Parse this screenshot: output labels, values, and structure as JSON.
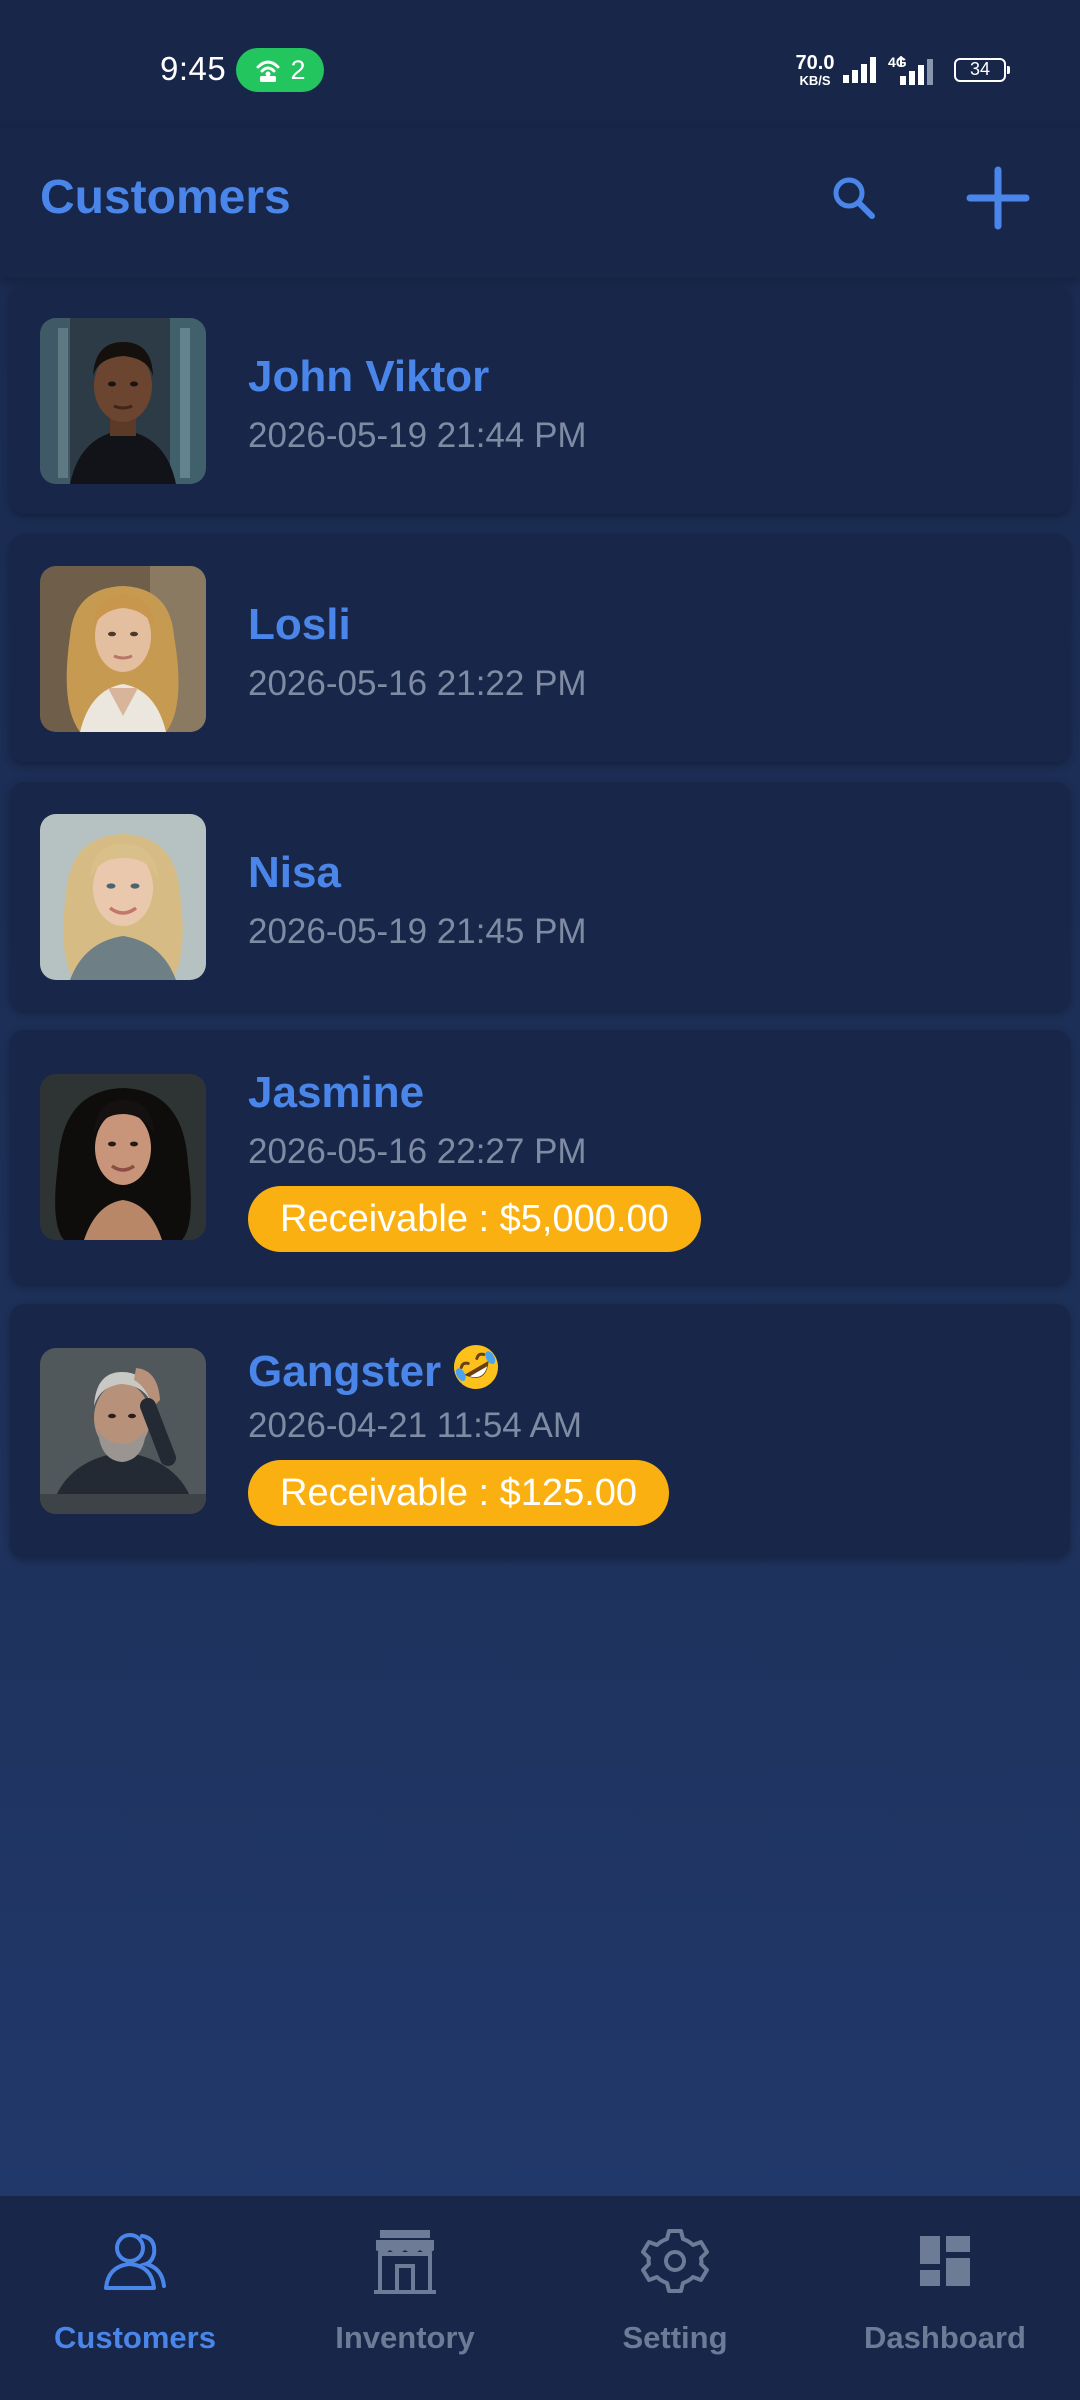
{
  "status_bar": {
    "time": "9:45",
    "hotspot_count": "2",
    "net_speed_value": "70.0",
    "net_speed_unit": "KB/S",
    "network_type": "4G",
    "battery_level": "34",
    "icons": [
      "wifi-hotspot-icon",
      "cell-signal-icon",
      "battery-icon"
    ]
  },
  "header": {
    "title": "Customers",
    "icons": [
      "search-icon",
      "add-icon"
    ]
  },
  "colors": {
    "accent": "#4a86ea",
    "background": "#1d3058",
    "card": "#182749",
    "receivable_badge": "#fbb012",
    "muted_text": "#7f8aa3"
  },
  "customers": [
    {
      "name": "John Viktor",
      "date": "2026-05-19 21:44 PM",
      "receivable": ""
    },
    {
      "name": "Losli",
      "date": "2026-05-16 21:22 PM",
      "receivable": ""
    },
    {
      "name": "Nisa",
      "date": "2026-05-19 21:45 PM",
      "receivable": ""
    },
    {
      "name": "Jasmine",
      "date": "2026-05-16 22:27 PM",
      "receivable": "Receivable : $5,000.00"
    },
    {
      "name": "Gangster",
      "name_emoji": "rolling-on-floor-laughing-emoji",
      "date": "2026-04-21 11:54 AM",
      "receivable": "Receivable : $125.00"
    }
  ],
  "bottom_nav": {
    "active": "Customers",
    "items": [
      {
        "label": "Customers",
        "icon": "customers-icon"
      },
      {
        "label": "Inventory",
        "icon": "store-icon"
      },
      {
        "label": "Setting",
        "icon": "gear-icon"
      },
      {
        "label": "Dashboard",
        "icon": "dashboard-icon"
      }
    ]
  }
}
